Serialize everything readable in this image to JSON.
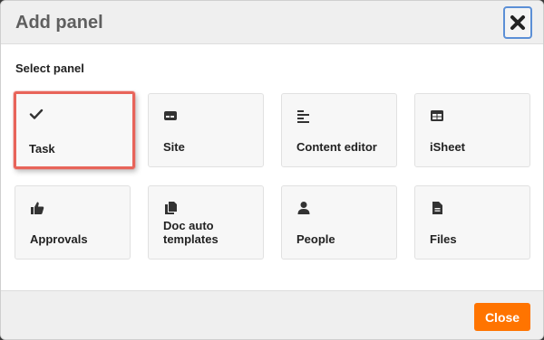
{
  "dialog": {
    "title": "Add panel",
    "close_icon": "close-x-icon",
    "section_label": "Select panel",
    "accent_color": "#ff7400",
    "highlight_color": "#e8645a"
  },
  "panels": [
    {
      "label": "Task",
      "icon": "checkmark-icon",
      "highlighted": true
    },
    {
      "label": "Site",
      "icon": "site-card-icon"
    },
    {
      "label": "Content editor",
      "icon": "text-lines-icon"
    },
    {
      "label": "iSheet",
      "icon": "table-icon"
    },
    {
      "label": "Approvals",
      "icon": "thumbs-up-icon"
    },
    {
      "label": "Doc auto templates",
      "icon": "documents-icon"
    },
    {
      "label": "People",
      "icon": "person-icon"
    },
    {
      "label": "Files",
      "icon": "file-icon"
    }
  ],
  "footer": {
    "close_label": "Close"
  }
}
